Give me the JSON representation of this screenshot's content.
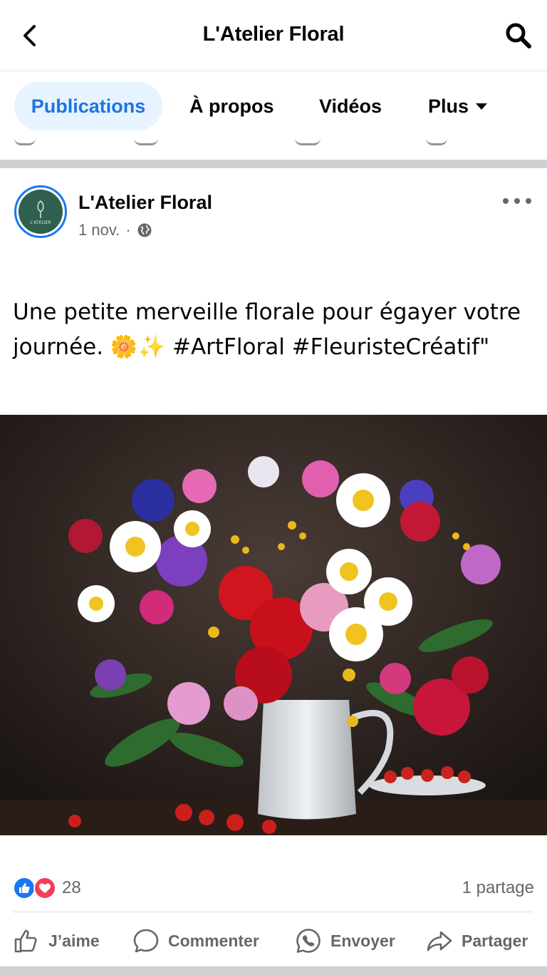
{
  "header": {
    "title": "L'Atelier Floral"
  },
  "tabs": [
    {
      "label": "Publications",
      "active": true
    },
    {
      "label": "À propos",
      "active": false
    },
    {
      "label": "Vidéos",
      "active": false
    },
    {
      "label": "Plus",
      "active": false
    }
  ],
  "post": {
    "author": "L'Atelier Floral",
    "avatar_text": "L'ATELIER",
    "date": "1 nov.",
    "dot": "·",
    "privacy_icon": "globe-icon",
    "text": "Une petite merveille florale pour égayer votre journée. 🌼✨ #ArtFloral #FleuristeCréatif\"",
    "image_description": "bouquet-photo",
    "reactions_count": "28",
    "shares": "1 partage"
  },
  "actions": {
    "like": "J’aime",
    "comment": "Commenter",
    "send": "Envoyer",
    "share": "Partager"
  },
  "colors": {
    "accent": "#1877f2",
    "tab_active_bg": "#e7f3ff",
    "tab_active_text": "#1b74e4",
    "like_blue": "#1877f2",
    "love_red": "#f33e58",
    "muted": "#65676b"
  }
}
